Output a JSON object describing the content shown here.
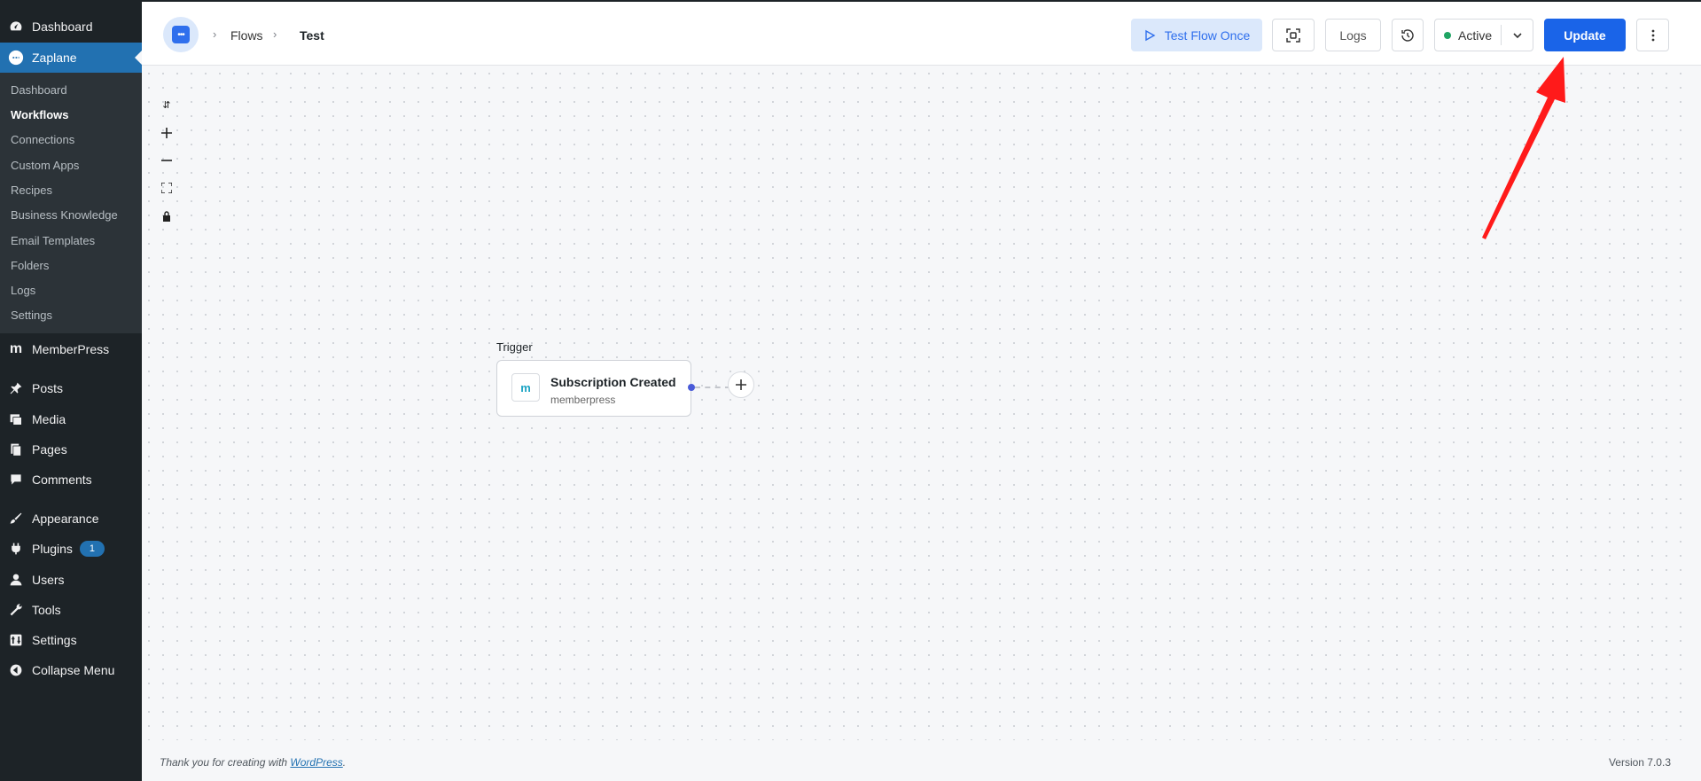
{
  "sidebar": {
    "items": [
      {
        "label": "Dashboard",
        "icon": "dashboard-icon"
      },
      {
        "label": "Zaplane",
        "icon": "zaplane-icon"
      },
      {
        "label": "MemberPress",
        "icon": "memberpress-icon"
      },
      {
        "label": "Posts",
        "icon": "pin-icon"
      },
      {
        "label": "Media",
        "icon": "media-icon"
      },
      {
        "label": "Pages",
        "icon": "pages-icon"
      },
      {
        "label": "Comments",
        "icon": "comment-icon"
      },
      {
        "label": "Appearance",
        "icon": "brush-icon"
      },
      {
        "label": "Plugins",
        "icon": "plugin-icon",
        "badge": "1"
      },
      {
        "label": "Users",
        "icon": "user-icon"
      },
      {
        "label": "Tools",
        "icon": "wrench-icon"
      },
      {
        "label": "Settings",
        "icon": "settings-icon"
      },
      {
        "label": "Collapse Menu",
        "icon": "collapse-icon"
      }
    ],
    "submenu": [
      "Dashboard",
      "Workflows",
      "Connections",
      "Custom Apps",
      "Recipes",
      "Business Knowledge",
      "Email Templates",
      "Folders",
      "Logs",
      "Settings"
    ],
    "current_submenu": "Workflows"
  },
  "header": {
    "breadcrumb": [
      "Flows",
      "Test"
    ],
    "test_flow_label": "Test Flow Once",
    "logs_label": "Logs",
    "status_label": "Active",
    "update_label": "Update"
  },
  "canvas": {
    "trigger_label": "Trigger",
    "node_title": "Subscription Created",
    "node_subtitle": "memberpress",
    "node_icon_text": "m"
  },
  "footer": {
    "thanks_prefix": "Thank you for creating with ",
    "thanks_link": "WordPress",
    "thanks_suffix": ".",
    "version": "Version 7.0.3"
  },
  "colors": {
    "accent": "#1a64e8",
    "wp_sidebar": "#1d2327",
    "wp_current": "#2271b1",
    "active_green": "#1fa463",
    "arrow": "#ff1a1a"
  }
}
